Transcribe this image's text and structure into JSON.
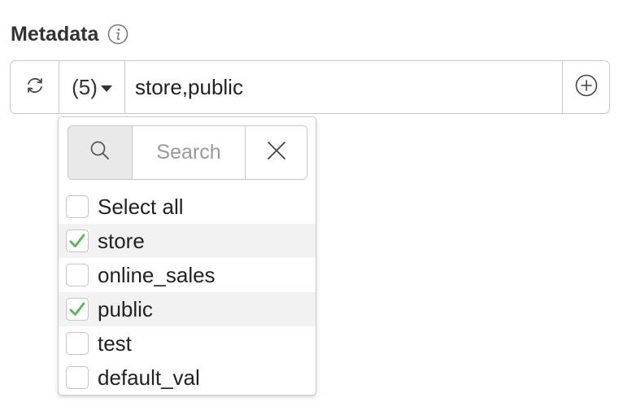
{
  "field": {
    "title": "Metadata",
    "info_icon": "info-icon",
    "count_label": "(5)",
    "value": "store,public",
    "refresh_icon": "refresh-icon",
    "add_icon": "plus-circle-icon"
  },
  "dropdown": {
    "search_placeholder": "Search",
    "search_icon": "search-icon",
    "clear_icon": "close-icon",
    "options": [
      {
        "label": "Select all",
        "checked": false
      },
      {
        "label": "store",
        "checked": true
      },
      {
        "label": "online_sales",
        "checked": false
      },
      {
        "label": "public",
        "checked": true
      },
      {
        "label": "test",
        "checked": false
      },
      {
        "label": "default_val",
        "checked": false
      }
    ]
  },
  "colors": {
    "check": "#5cb85c",
    "border": "#c8c8c8",
    "addon_bg": "#e9e9e9",
    "selected_row_bg": "#f2f2f2"
  }
}
